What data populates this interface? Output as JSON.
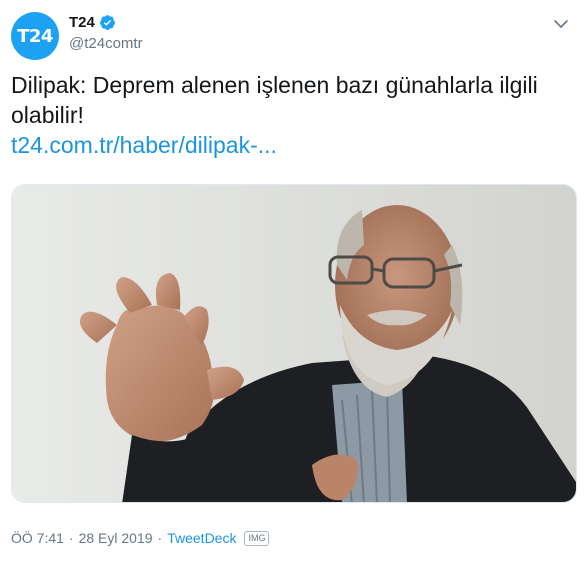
{
  "account": {
    "avatar_text": "T24",
    "avatar_color": "#1da1f2",
    "name": "T24",
    "handle": "@t24comtr",
    "verified": true
  },
  "tweet": {
    "text": "Dilipak: Deprem alenen işlenen bazı günahlarla ilgili olabilir!",
    "link_text": "t24.com.tr/haber/dilipak-..."
  },
  "media": {
    "subject": "photo of a grey-bearded man in glasses and a dark suit, gesturing with raised hand"
  },
  "meta": {
    "time": "ÖÖ 7:41",
    "separator": "·",
    "date": "28 Eyl 2019",
    "source": "TweetDeck",
    "badge": "IMG"
  },
  "colors": {
    "link": "#1b95e0",
    "secondary_text": "#657786",
    "verified": "#1da1f2"
  },
  "icons": [
    "verified-badge-icon",
    "chevron-down-icon",
    "photo-image"
  ]
}
